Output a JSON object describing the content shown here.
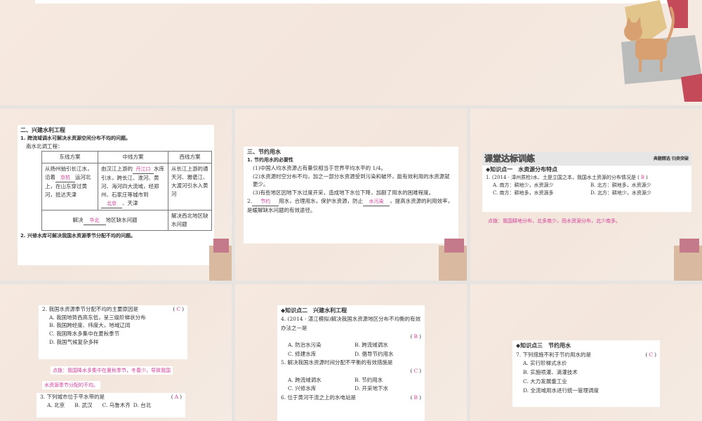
{
  "s2": {
    "title": "二、兴建水利工程",
    "p1": "1. 跨流域调水可解决水资源空间分布不均的问题。",
    "p1sub": "南水北调工程：",
    "headers": [
      "东线方案",
      "中线方案",
      "西线方案"
    ],
    "east": [
      "从扬州抽引长江水，沿着",
      "运河北上，在山东穿过黄河，抵达天津"
    ],
    "east_ans": "京杭",
    "mid": [
      "由汉江上游的",
      "水库引水，跨长江、淮河、黄河、海河四大流域，经郑州、石家庄等城市到",
      "、天津"
    ],
    "mid_ans1": "丹江口",
    "mid_ans2": "北京",
    "west": "从长江上游的通天河、雅砻江、大渡河引水入黄河",
    "solve": [
      "解决",
      "地区缺水问题"
    ],
    "solve_ans": "华北",
    "west_solve": "解决西北地区缺水问题",
    "p2": "2. 兴修水库可解决我国水资源季节分配不均的问题。"
  },
  "s3": {
    "title": "三、节约用水",
    "p1": "1. 节约用水的必要性",
    "i1": "(1)中国人均水资源占有量仅相当于世界平均水平的 1/4。",
    "i2": "(2)水资源时空分布不均，加之一部分水资源受到污染和破坏，能有效利用的水资源就更少。",
    "i3": "(3)有些地区因地下水过度开采，造成地下水位下降，加剧了用水的困难程度。",
    "p2": [
      "2.",
      "用水，合理用水，保护水资源，防止",
      "，提高水资源的利用效率，是缓解缺水问题的有效途径。"
    ],
    "ans1": "节约",
    "ans2": "水污染"
  },
  "s4": {
    "banner": "课堂达标训练",
    "banner_right": "典题精选 归类突破",
    "kp": "◆知识点一　水资源分布特点",
    "q": "1. (2014 · 漳州质检)水、土是立国之本，我国水土资源的分布情况是 (",
    "ans": "B",
    "opts": [
      "A. 南方：耕地少，水资源少",
      "B. 北方：耕地多，水资源少",
      "C. 南方：耕地多，水资源多",
      "D. 北方：耕地少，水资源少"
    ],
    "tip": "点拨：我国耕地分布，北多南少，而水资源分布，北少南多。"
  },
  "s5": {
    "q2": "2. 我国水资源季节分配不均的主要原因是",
    "ans2": "C",
    "opts2": [
      "A. 我国地势西高东低，呈三级阶梯状分布",
      "B. 我国跨经度、纬度大，地域辽阔",
      "C. 我国降水多集中在夏秋季节",
      "D. 我国气候复杂多样"
    ],
    "tip1": "点拨：我国降水多集中在夏秋季节，冬春少，导致我国",
    "tip2": "水资源季节分配的不均。",
    "q3": "3. 下列城市位于平水带的是",
    "ans3": "A",
    "opts3": [
      "A. 北京",
      "B. 武汉",
      "C. 乌鲁木齐",
      "D. 台北"
    ]
  },
  "s6": {
    "kp": "◆知识点二　兴建水利工程",
    "q4": "4. (2014 · 湛江模拟)解决我国水资源地区分布不均衡的有效办法之一是",
    "ans4": "B",
    "opts4": [
      "A. 防治水污染",
      "B. 跨流域调水",
      "C. 修建水库",
      "D. 倡导节约用水"
    ],
    "q5": "5. 解决我国水资源时间分配不平衡的有效措施是",
    "ans5": "C",
    "opts5": [
      "A. 跨流域调水",
      "B. 节约用水",
      "C. 兴修水库",
      "D. 开采地下水"
    ],
    "q6": "6. 位于黄河干流之上的水电站是",
    "ans6": "B"
  },
  "s7": {
    "kp": "◆知识点三　节约用水",
    "q7": "7. 下列措施不利于节约用水的是",
    "ans7": "C",
    "opts7": [
      "A. 实行阶梯式水价",
      "B. 实施喷灌、滴灌技术",
      "C. 大力发展重工业",
      "D. 全流域用水进行统一管理调度"
    ]
  },
  "paren_open": "(",
  "paren_close": ")"
}
